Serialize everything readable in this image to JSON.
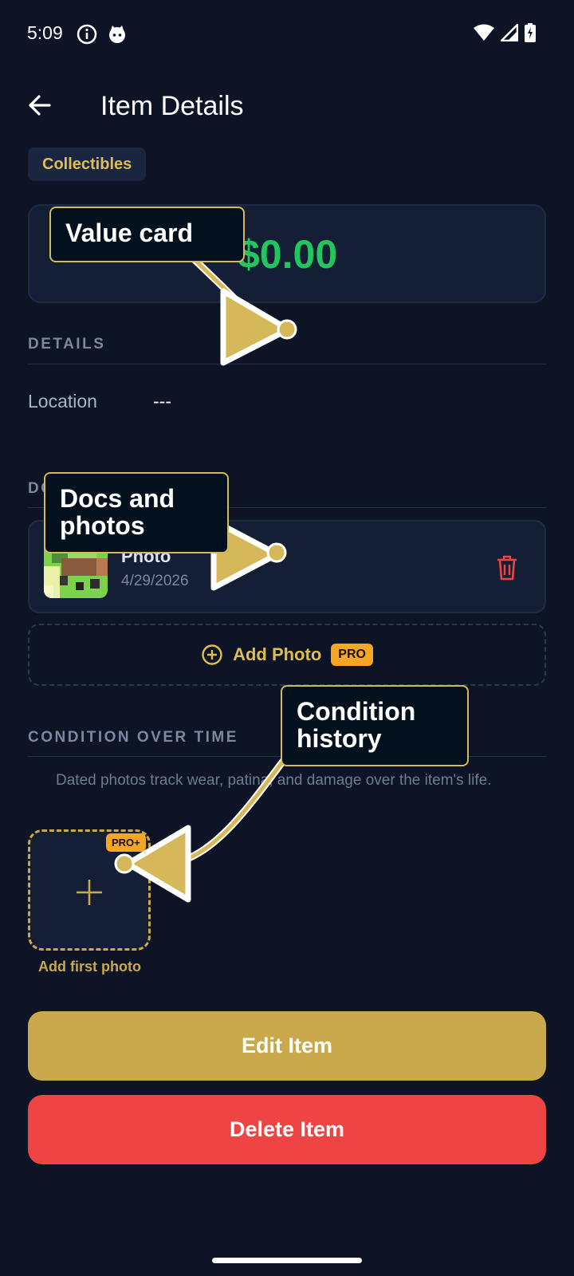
{
  "status_bar": {
    "time": "5:09",
    "icons_left": [
      "info-icon",
      "cat-icon"
    ],
    "icons_right": [
      "wifi-icon",
      "signal-icon",
      "battery-charging-icon"
    ]
  },
  "app_bar": {
    "back_icon": "arrow-left-icon",
    "title": "Item Details"
  },
  "category": "Collectibles",
  "value_card": {
    "amount": "$0.00",
    "amount_color": "#22c55e"
  },
  "details": {
    "header": "DETAILS",
    "rows": [
      {
        "label": "Location",
        "value": "---"
      }
    ]
  },
  "documents": {
    "header_partial": "DO",
    "items": [
      {
        "name": "Photo",
        "date": "4/29/2026"
      }
    ],
    "add_photo": {
      "label": "Add Photo",
      "badge": "PRO"
    }
  },
  "condition": {
    "header": "CONDITION OVER TIME",
    "description": "Dated photos track wear, patina, and damage over the item's life.",
    "add_first": {
      "badge": "PRO+",
      "caption": "Add first photo"
    }
  },
  "actions": {
    "edit": "Edit Item",
    "delete": "Delete Item"
  },
  "tutorial": {
    "value_card": "Value card",
    "docs_photos_line1": "Docs and",
    "docs_photos_line2": "photos",
    "condition_line1": "Condition",
    "condition_line2": "history"
  },
  "colors": {
    "background": "#0c1426",
    "gold": "#c9a94b",
    "danger": "#ef4444",
    "pro": "#f5a623"
  }
}
